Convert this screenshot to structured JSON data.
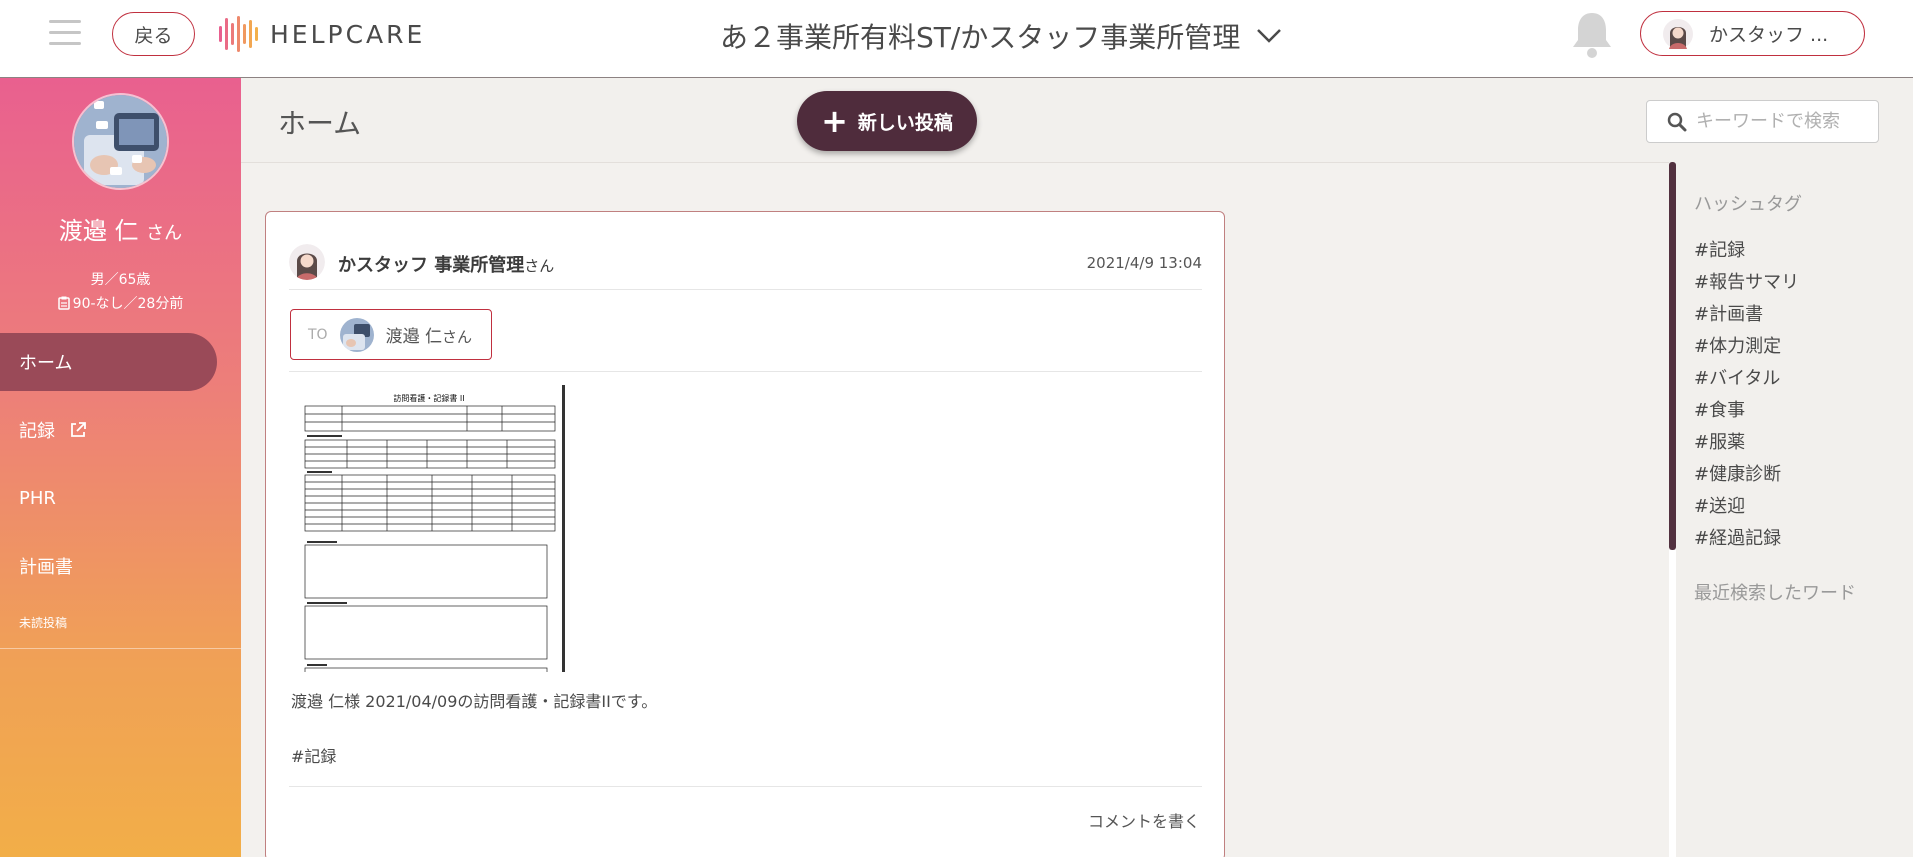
{
  "header": {
    "back_label": "戻る",
    "logo_text": "HELPCARE",
    "office_selector": "あ２事業所有料ST/かスタッフ事業所管理",
    "user_name": "かスタッフ ..."
  },
  "sidebar": {
    "patient_name": "渡邉 仁",
    "patient_suffix": "さん",
    "gender_age": "男／65歳",
    "care_info": "90-なし／28分前",
    "nav": [
      {
        "label": "ホーム",
        "active": true
      },
      {
        "label": "記録",
        "external": true
      },
      {
        "label": "PHR"
      },
      {
        "label": "計画書"
      }
    ],
    "unread_label": "未読投稿"
  },
  "subheader": {
    "title": "ホーム",
    "new_post_label": "新しい投稿",
    "search_placeholder": "キーワードで検索"
  },
  "post": {
    "author": "かスタッフ 事業所管理",
    "author_suffix": "さん",
    "date": "2021/4/9 13:04",
    "to_label": "TO",
    "to_name": "渡邉 仁",
    "to_suffix": "さん",
    "attachment_title": "訪問看護・記録書 II",
    "body": "渡邉 仁様 2021/04/09の訪問看護・記録書IIです。",
    "hashtag": "#記録",
    "comment_label": "コメントを書く"
  },
  "hashtags": {
    "heading": "ハッシュタグ",
    "items": [
      "#記録",
      "#報告サマリ",
      "#計画書",
      "#体力測定",
      "#バイタル",
      "#食事",
      "#服薬",
      "#健康診断",
      "#送迎",
      "#経過記録"
    ],
    "recent_heading": "最近検索したワード"
  },
  "colors": {
    "accent": "#c0303f",
    "primary_button": "#4f2c3c",
    "sidebar_gradient_top": "#e9608f",
    "sidebar_gradient_bottom": "#f2ae48",
    "nav_active": "#9a4a58"
  },
  "icons": [
    "menu-icon",
    "notification-bell-icon",
    "chevron-down-icon",
    "external-link-icon",
    "clipboard-icon",
    "plus-icon",
    "search-icon"
  ]
}
